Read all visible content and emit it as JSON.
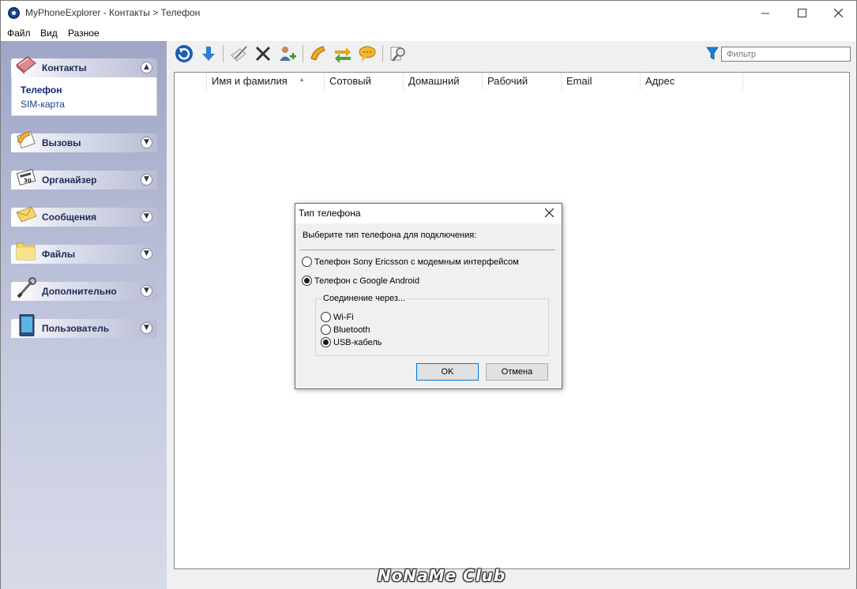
{
  "window": {
    "title": "MyPhoneExplorer -  Контакты > Телефон",
    "watermark": "NoNaMe Club"
  },
  "menu": [
    "Файл",
    "Вид",
    "Разное"
  ],
  "sidebar": {
    "sections": [
      {
        "label": "Контакты",
        "icon": "contacts-book-icon",
        "expanded": true,
        "links": [
          {
            "label": "Телефон",
            "active": true
          },
          {
            "label": "SIM-карта",
            "active": false
          }
        ]
      },
      {
        "label": "Вызовы",
        "icon": "phone-handset-icon"
      },
      {
        "label": "Органайзер",
        "icon": "organizer-icon"
      },
      {
        "label": "Сообщения",
        "icon": "envelope-icon"
      },
      {
        "label": "Файлы",
        "icon": "folder-icon"
      },
      {
        "label": "Дополнительно",
        "icon": "tools-icon"
      },
      {
        "label": "Пользователь",
        "icon": "device-icon"
      }
    ]
  },
  "toolbar": {
    "filter_placeholder": "Фильтр",
    "icons": [
      "refresh-icon",
      "download-icon",
      "edit-icon",
      "delete-icon",
      "add-contact-icon",
      "call-icon",
      "sync-icon",
      "sms-icon",
      "search-icon"
    ]
  },
  "list": {
    "columns": [
      "",
      "Имя и фамилия",
      "Сотовый",
      "Домашний",
      "Рабочий",
      "Email",
      "Адрес"
    ],
    "sort_column": "Имя и фамилия"
  },
  "dialog": {
    "title": "Тип телефона",
    "prompt": "Выберите тип телефона для подключения:",
    "phone_types": [
      {
        "label": "Телефон Sony Ericsson с модемным интерфейсом",
        "checked": false
      },
      {
        "label": "Телефон с Google Android",
        "checked": true
      }
    ],
    "connection_group_label": "Соединение через...",
    "connections": [
      {
        "label": "Wi-Fi",
        "checked": false
      },
      {
        "label": "Bluetooth",
        "checked": false
      },
      {
        "label": "USB-кабель",
        "checked": true
      }
    ],
    "ok_label": "OK",
    "cancel_label": "Отмена"
  }
}
